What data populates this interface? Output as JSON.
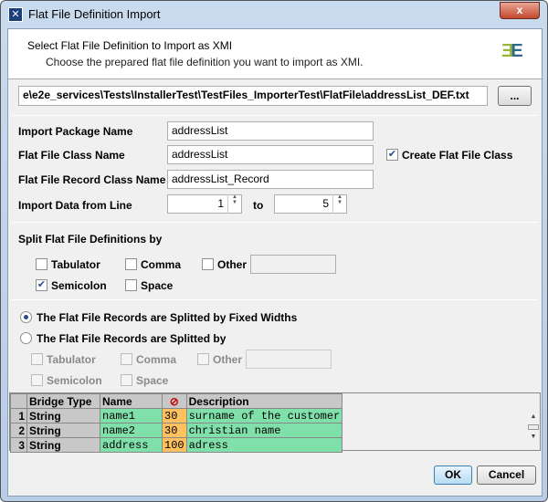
{
  "window": {
    "title": "Flat File Definition Import",
    "close": "x"
  },
  "header": {
    "title": "Select Flat File Definition to Import as XMI",
    "subtitle": "Choose the prepared flat file definition you want to import as XMI.",
    "logo": "E2E"
  },
  "file": {
    "path": "e\\e2e_services\\Tests\\InstallerTest\\TestFiles_ImporterTest\\FlatFile\\addressList_DEF.txt",
    "browse": "..."
  },
  "form": {
    "package_label": "Import Package Name",
    "package_value": "addressList",
    "class_label": "Flat File Class Name",
    "class_value": "addressList",
    "create_class_label": "Create Flat File Class",
    "create_class_checked": true,
    "record_label": "Flat File Record Class Name",
    "record_value": "addressList_Record",
    "line_label": "Import Data from Line",
    "line_from": "1",
    "to_label": "to",
    "line_to": "5"
  },
  "split": {
    "title": "Split Flat File Definitions by",
    "tabulator": "Tabulator",
    "comma": "Comma",
    "other": "Other",
    "semicolon": "Semicolon",
    "space": "Space",
    "semicolon_checked": true
  },
  "records": {
    "fixed_label": "The Flat File Records are Splitted by Fixed Widths",
    "splitby_label": "The Flat File Records are Splitted by",
    "selected": "fixed",
    "tabulator": "Tabulator",
    "comma": "Comma",
    "other": "Other",
    "semicolon": "Semicolon",
    "space": "Space"
  },
  "table": {
    "headers": [
      "",
      "Bridge Type",
      "Name",
      "⊘",
      "Description"
    ],
    "rows": [
      [
        "1",
        "String",
        "name1",
        "30",
        "surname of the customer"
      ],
      [
        "2",
        "String",
        "name2",
        "30",
        "christian name"
      ],
      [
        "3",
        "String",
        "address",
        "100",
        "adress"
      ]
    ]
  },
  "colors": {
    "name_cell": "#80e0aa",
    "length_cell": "#ffc060"
  },
  "buttons": {
    "ok": "OK",
    "cancel": "Cancel"
  }
}
